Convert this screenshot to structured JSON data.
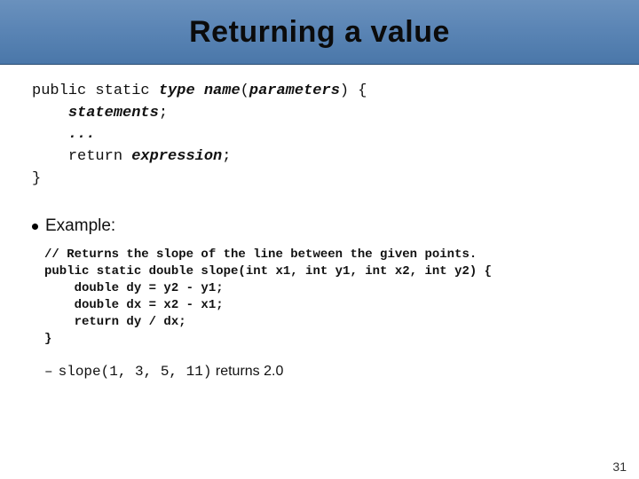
{
  "title": "Returning a value",
  "syntax": {
    "kw_public": "public",
    "kw_static": "static",
    "type": "type",
    "name": "name",
    "lparen": "(",
    "params": "parameters",
    "rparen": ")",
    "lbrace": " {",
    "stmt": "statements",
    "semi": ";",
    "dots": "...",
    "kw_return": "return",
    "expr": "expression",
    "rbrace": "}"
  },
  "example_label": "Example:",
  "code": {
    "l1": "// Returns the slope of the line between the given points.",
    "l2": "public static double slope(int x1, int y1, int x2, int y2) {",
    "l3": "    double dy = y2 - y1;",
    "l4": "    double dx = x2 - x1;",
    "l5": "    return dy / dx;",
    "l6": "}"
  },
  "result": {
    "dash": "–",
    "call": "slope(1, 3, 5, 11)",
    "word": " returns ",
    "value": "2.0"
  },
  "page_number": "31"
}
